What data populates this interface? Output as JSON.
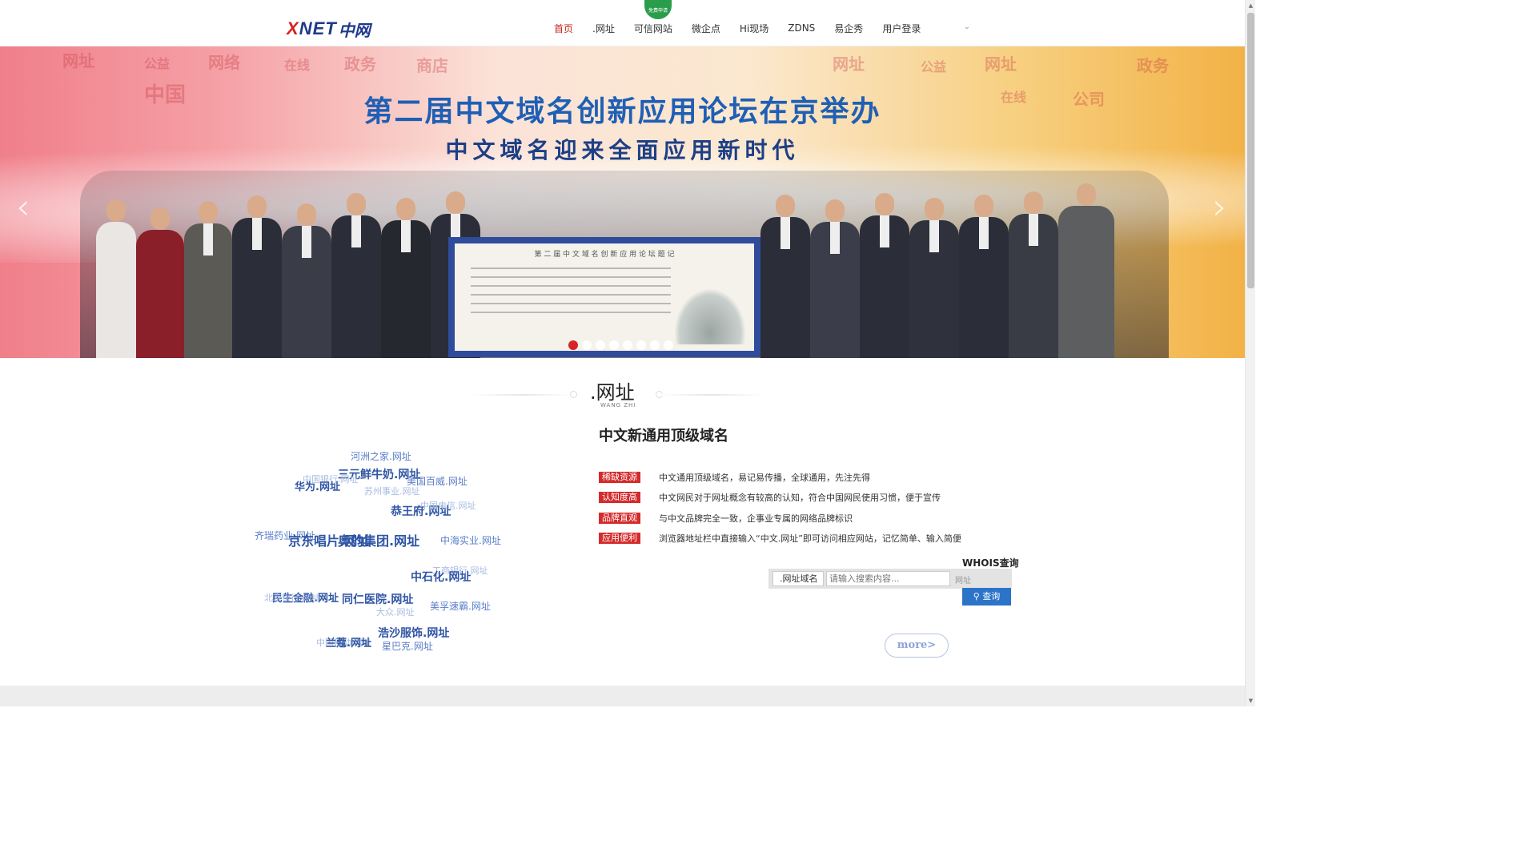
{
  "header": {
    "logo_latin": "NET",
    "logo_latin_prefix": "X",
    "logo_cn": "中网",
    "nav": [
      {
        "label": "首页",
        "active": true
      },
      {
        "label": ".网址",
        "active": false
      },
      {
        "label": "可信网站",
        "active": false
      },
      {
        "label": "微企点",
        "active": false
      },
      {
        "label": "Hi现场",
        "active": false
      },
      {
        "label": "ZDNS",
        "active": false
      },
      {
        "label": "易企秀",
        "active": false
      },
      {
        "label": "用户登录",
        "active": false
      }
    ],
    "nav_badge": "免费申请",
    "dropdown_icon": "chevron-down-icon"
  },
  "banner": {
    "title": "第二届中文域名创新应用论坛在京举办",
    "subtitle": "中文域名迎来全面应用新时代",
    "background_words": [
      "网址",
      "公益",
      "网络",
      "在线",
      "政务",
      "商店",
      "中国",
      "网址",
      "公益",
      "政务",
      "网址",
      "公司",
      "在线"
    ],
    "prev_icon": "chevron-left-icon",
    "next_icon": "chevron-right-icon",
    "slide_count": 8,
    "active_slide": 0
  },
  "section": {
    "title": ".网址",
    "subtitle": "WANG ZHI"
  },
  "tag_cloud": [
    "河洲之家.网址",
    "三元鲜牛奶.网址",
    "中国银行.网址",
    "美国百威.网址",
    "华为.网址",
    "苏州事业.网址",
    "恭王府.网址",
    "中国电信.网址",
    "齐瑞药业.网址",
    "京东唱片.网址",
    "奥的集团.网址",
    "中海实业.网址",
    "工商银行.网址",
    "中石化.网址",
    "民生金融.网址",
    "北京银行.网址",
    "同仁医院.网址",
    "美孚速霸.网址",
    "大众.网址",
    "浩沙服饰.网址",
    "中国移动.网址",
    "兰蔻.网址",
    "星巴克.网址"
  ],
  "features": {
    "title": "中文新通用顶级域名",
    "items": [
      {
        "badge": "稀缺资源",
        "text": "中文通用顶级域名，易记易传播，全球通用，先注先得"
      },
      {
        "badge": "认知度高",
        "text": "中文网民对于网址概念有较高的认知，符合中国网民使用习惯，便于宣传"
      },
      {
        "badge": "品牌直观",
        "text": "与中文品牌完全一致，企事业专属的网络品牌标识"
      },
      {
        "badge": "应用便利",
        "text": "浏览器地址栏中直接输入“中文.网址”即可访问相应网站，记忆简单、输入简便"
      }
    ]
  },
  "whois": {
    "label": "WHOIS查询",
    "select_value": ".网址域名",
    "placeholder": "请输入搜索内容...",
    "suffix": "网址",
    "button": "查询",
    "button_icon": "search-icon"
  },
  "more_label": "more>",
  "colors": {
    "brand_red": "#d42b2b",
    "brand_blue": "#1f3a8c",
    "button_blue": "#2b74c8"
  }
}
